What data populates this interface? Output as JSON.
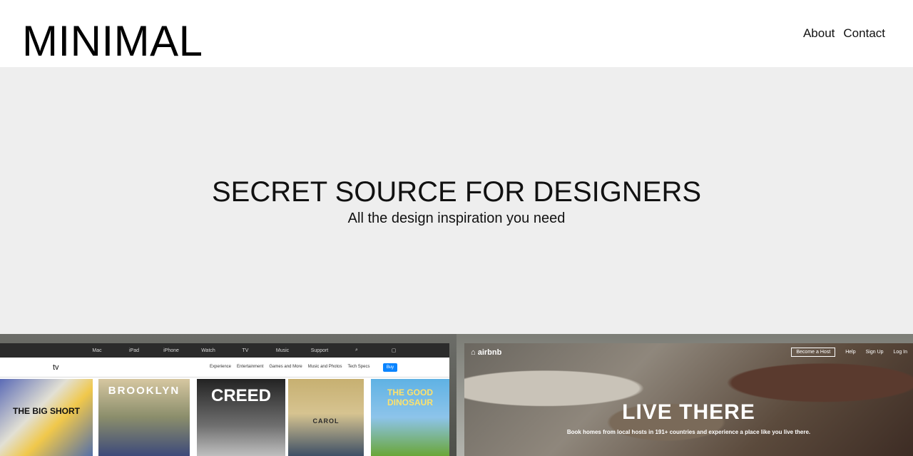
{
  "header": {
    "logo": "MINIMAL",
    "nav": [
      {
        "label": "About"
      },
      {
        "label": "Contact"
      }
    ]
  },
  "hero": {
    "title": "SECRET SOURCE FOR DESIGNERS",
    "subtitle": "All the design inspiration you need"
  },
  "gallery": {
    "apple": {
      "global_nav": [
        "Mac",
        "iPad",
        "iPhone",
        "Watch",
        "TV",
        "Music",
        "Support"
      ],
      "apple_icon": "apple-icon",
      "search_icon": "search-icon",
      "bag_icon": "bag-icon",
      "tv_logo": "tv",
      "sub_nav": [
        "Experience",
        "Entertainment",
        "Games and More",
        "Music and Photos",
        "Tech Specs"
      ],
      "buy_label": "Buy",
      "posters": [
        "THE BIG SHORT",
        "BROOKLYN",
        "CREED",
        "CAROL",
        "THE GOOD DINOSAUR"
      ]
    },
    "airbnb": {
      "logo": "airbnb",
      "nav": [
        "Become a Host",
        "Help",
        "Sign Up",
        "Log In"
      ],
      "hero": "LIVE THERE",
      "subtitle": "Book homes from local hosts in 191+ countries and experience a place like you live there."
    }
  }
}
